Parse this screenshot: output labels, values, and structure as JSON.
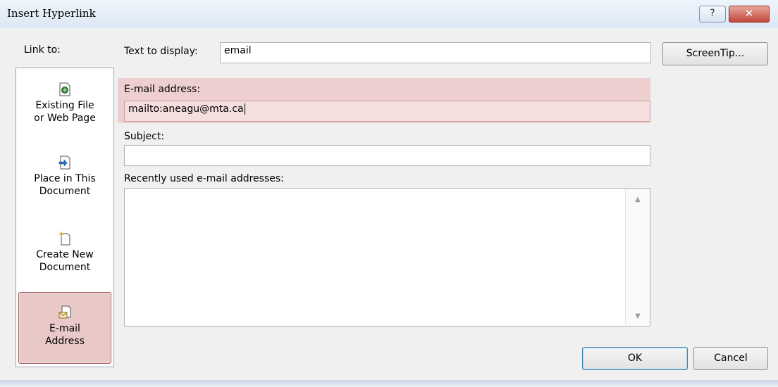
{
  "window": {
    "title": "Insert Hyperlink",
    "help_label": "?",
    "close_label": "✕"
  },
  "sidebar": {
    "header": "Link to:",
    "items": [
      {
        "line1": "Existing File",
        "line2": "or Web Page",
        "icon": "existing-file-icon"
      },
      {
        "line1": "Place in This",
        "line2": "Document",
        "icon": "place-in-document-icon"
      },
      {
        "line1": "Create New",
        "line2": "Document",
        "icon": "create-new-document-icon"
      },
      {
        "line1": "E-mail",
        "line2": "Address",
        "icon": "email-address-icon",
        "selected": true
      }
    ]
  },
  "form": {
    "text_to_display_label": "Text to display:",
    "text_to_display_value": "email",
    "email_label": "E-mail address:",
    "email_value": "mailto:aneagu@mta.ca",
    "subject_label": "Subject:",
    "subject_value": "",
    "recent_label": "Recently used e-mail addresses:"
  },
  "buttons": {
    "screentip": "ScreenTip...",
    "ok": "OK",
    "cancel": "Cancel"
  },
  "colors": {
    "selection": "#e9c8c8",
    "title_gradient_top": "#eef4fb",
    "close_button": "#c3473a"
  }
}
